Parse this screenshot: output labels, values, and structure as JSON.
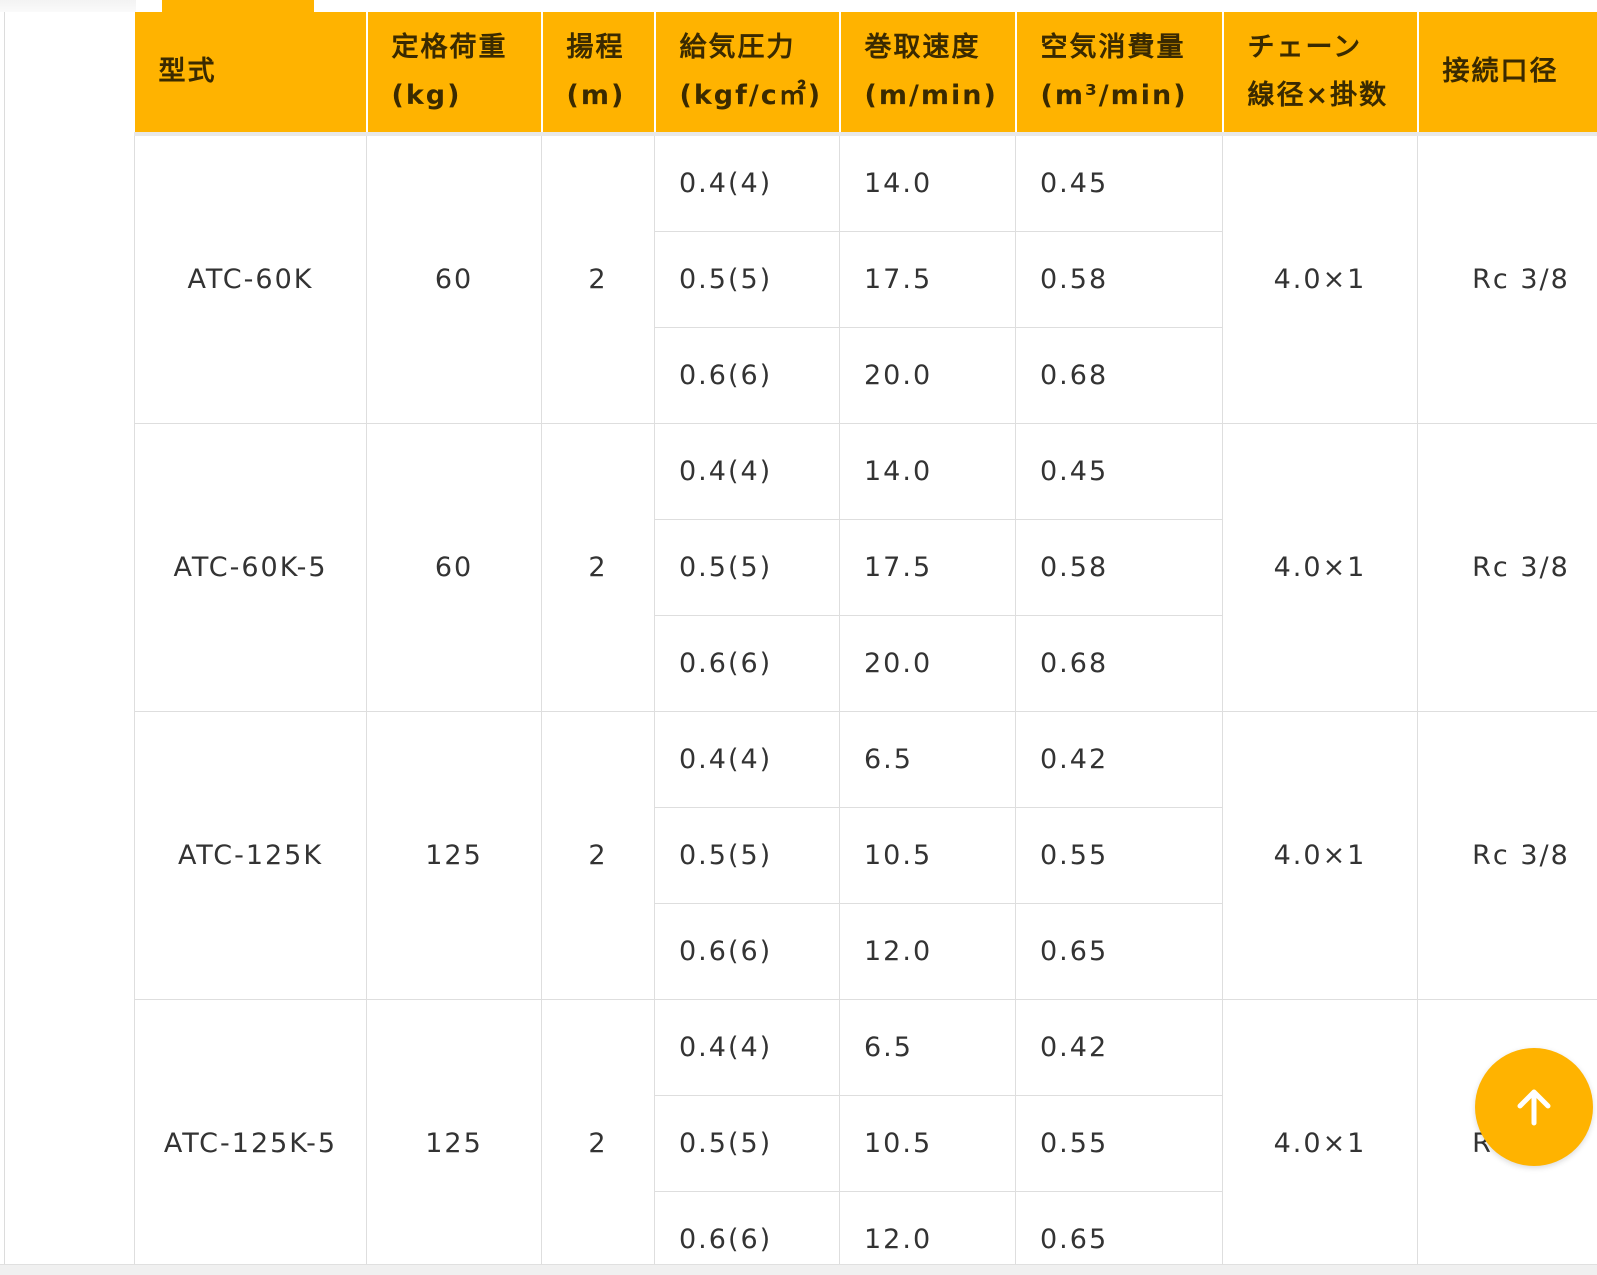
{
  "table": {
    "headers": [
      {
        "line1": "",
        "line2": "型式"
      },
      {
        "line1": "定格荷重",
        "line2": "(kg)"
      },
      {
        "line1": "揚程",
        "line2": "(m)"
      },
      {
        "line1": "給気圧力",
        "line2": "(kgf/c㎡)"
      },
      {
        "line1": "巻取速度",
        "line2": "(m/min)"
      },
      {
        "line1": "空気消費量",
        "line2": "(m³/min)"
      },
      {
        "line1": "チェーン",
        "line2": "線径×掛数"
      },
      {
        "line1": "",
        "line2": "接続口径"
      }
    ],
    "models": [
      {
        "model": "ATC-60K",
        "load": "60",
        "lift": "2",
        "rows": [
          {
            "pressure": "0.4(4)",
            "speed": "14.0",
            "air": "0.45"
          },
          {
            "pressure": "0.5(5)",
            "speed": "17.5",
            "air": "0.58"
          },
          {
            "pressure": "0.6(6)",
            "speed": "20.0",
            "air": "0.68"
          }
        ],
        "chain": "4.0×1",
        "port": "Rc 3/8"
      },
      {
        "model": "ATC-60K-5",
        "load": "60",
        "lift": "2",
        "rows": [
          {
            "pressure": "0.4(4)",
            "speed": "14.0",
            "air": "0.45"
          },
          {
            "pressure": "0.5(5)",
            "speed": "17.5",
            "air": "0.58"
          },
          {
            "pressure": "0.6(6)",
            "speed": "20.0",
            "air": "0.68"
          }
        ],
        "chain": "4.0×1",
        "port": "Rc 3/8"
      },
      {
        "model": "ATC-125K",
        "load": "125",
        "lift": "2",
        "rows": [
          {
            "pressure": "0.4(4)",
            "speed": "6.5",
            "air": "0.42"
          },
          {
            "pressure": "0.5(5)",
            "speed": "10.5",
            "air": "0.55"
          },
          {
            "pressure": "0.6(6)",
            "speed": "12.0",
            "air": "0.65"
          }
        ],
        "chain": "4.0×1",
        "port": "Rc 3/8"
      },
      {
        "model": "ATC-125K-5",
        "load": "125",
        "lift": "2",
        "rows": [
          {
            "pressure": "0.4(4)",
            "speed": "6.5",
            "air": "0.42"
          },
          {
            "pressure": "0.5(5)",
            "speed": "10.5",
            "air": "0.55"
          },
          {
            "pressure": "0.6(6)",
            "speed": "12.0",
            "air": "0.65"
          }
        ],
        "chain": "4.0×1",
        "port": "Rc 3/8"
      }
    ]
  },
  "scroll_top": {
    "icon": "arrow-up-icon",
    "color": "#ffb300"
  },
  "colors": {
    "header_bg": "#ffb300",
    "border": "#dedede",
    "text": "#333333"
  }
}
